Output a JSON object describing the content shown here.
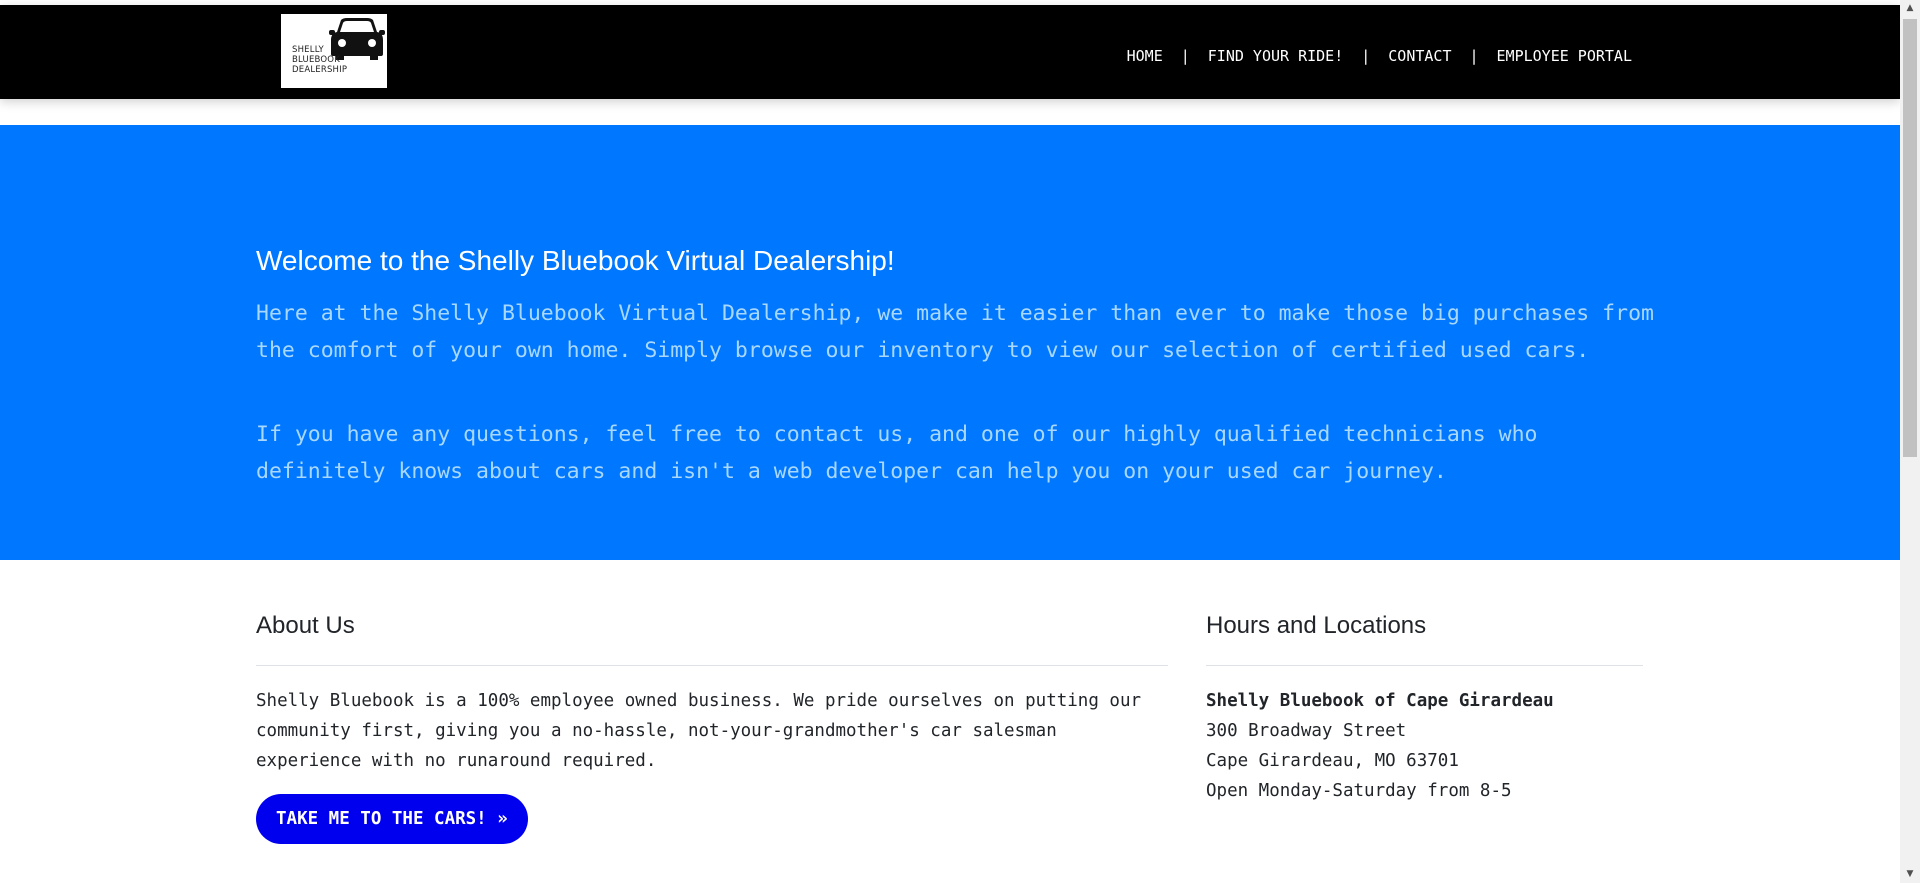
{
  "logo": {
    "text": "SHELLY\nBLUEBOOK\nDEALERSHIP",
    "icon": "car-icon"
  },
  "nav": {
    "items": [
      {
        "label": "HOME"
      },
      {
        "label": "FIND YOUR RIDE!"
      },
      {
        "label": "CONTACT"
      },
      {
        "label": "EMPLOYEE PORTAL"
      }
    ],
    "separator": "|"
  },
  "hero": {
    "title": "Welcome to the Shelly Bluebook Virtual Dealership!",
    "paragraph1": "Here at the Shelly Bluebook Virtual Dealership, we make it easier than ever to make those big purchases from the comfort of your own home. Simply browse our inventory to view our selection of certified used cars.",
    "paragraph2": "If you have any questions, feel free to contact us, and one of our highly qualified technicians who definitely knows about cars and isn't a web developer can help you on your used car journey."
  },
  "about": {
    "heading": "About Us",
    "body": "Shelly Bluebook is a 100% employee owned business. We pride ourselves on putting our community first, giving you a no-hassle, not-your-grandmother's car salesman experience with no runaround required.",
    "button_label": "TAKE ME TO THE CARS! »"
  },
  "hours": {
    "heading": "Hours and Locations",
    "location_name": "Shelly Bluebook of Cape Girardeau",
    "street": "300 Broadway Street",
    "city": "Cape Girardeau, MO 63701",
    "hours": "Open Monday-Saturday from 8-5"
  },
  "colors": {
    "navbar": "#000000",
    "hero": "#0077ff",
    "hero_text": "#a9d8ff",
    "button": "#0000ee"
  }
}
